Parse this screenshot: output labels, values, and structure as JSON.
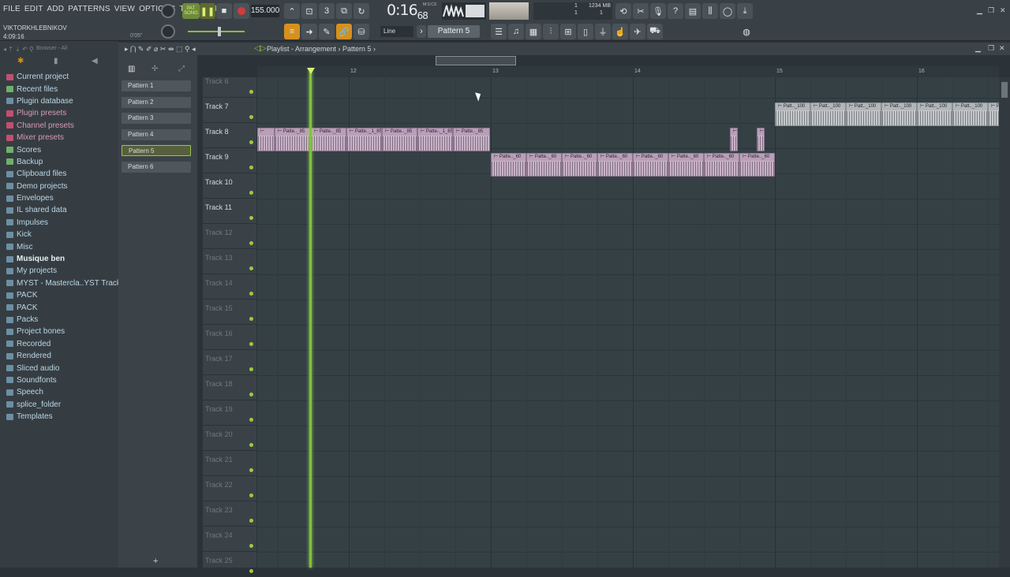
{
  "menu": [
    "FILE",
    "EDIT",
    "ADD",
    "PATTERNS",
    "VIEW",
    "OPTIONS",
    "TOOLS",
    "HELP"
  ],
  "hint": {
    "user": "VIKTORKHLEBNIKOV",
    "duration": "4:09:16",
    "small": "0'05\""
  },
  "transport": {
    "song_label": "SONG",
    "pat_label": "PAT",
    "tempo": "155.000",
    "time_main": "0:16",
    "time_sub": "68",
    "time_unit": "M:S:CS"
  },
  "cpu": {
    "val1": "1",
    "mem": "1234 MB",
    "val2": "1",
    "val3": "1"
  },
  "toolbar2": {
    "mode": "Line",
    "pattern": "Pattern 5"
  },
  "browser": {
    "title": "Browser - All",
    "items": [
      {
        "label": "Current project",
        "style": "accent"
      },
      {
        "label": "Recent files",
        "style": "green"
      },
      {
        "label": "Plugin database",
        "style": "normal"
      },
      {
        "label": "Plugin presets",
        "style": "pink"
      },
      {
        "label": "Channel presets",
        "style": "pink"
      },
      {
        "label": "Mixer presets",
        "style": "pink"
      },
      {
        "label": "Scores",
        "style": "green"
      },
      {
        "label": "Backup",
        "style": "green"
      },
      {
        "label": "Clipboard files",
        "style": "normal"
      },
      {
        "label": "Demo projects",
        "style": "normal"
      },
      {
        "label": "Envelopes",
        "style": "normal"
      },
      {
        "label": "IL shared data",
        "style": "normal"
      },
      {
        "label": "Impulses",
        "style": "normal"
      },
      {
        "label": "Kick",
        "style": "normal"
      },
      {
        "label": "Misc",
        "style": "normal"
      },
      {
        "label": "Musique ben",
        "style": "sel"
      },
      {
        "label": "My projects",
        "style": "normal"
      },
      {
        "label": "MYST - Mastercla..YST Track Ever",
        "style": "normal"
      },
      {
        "label": "PACK",
        "style": "normal"
      },
      {
        "label": "PACK",
        "style": "normal"
      },
      {
        "label": "Packs",
        "style": "normal"
      },
      {
        "label": "Project bones",
        "style": "normal"
      },
      {
        "label": "Recorded",
        "style": "normal"
      },
      {
        "label": "Rendered",
        "style": "normal"
      },
      {
        "label": "Sliced audio",
        "style": "normal"
      },
      {
        "label": "Soundfonts",
        "style": "normal"
      },
      {
        "label": "Speech",
        "style": "normal"
      },
      {
        "label": "splice_folder",
        "style": "normal"
      },
      {
        "label": "Templates",
        "style": "normal"
      }
    ]
  },
  "playlist": {
    "title": "Playlist - Arrangement › Pattern 5 ›",
    "patterns": [
      "Pattern 1",
      "Pattern 2",
      "Pattern 3",
      "Pattern 4",
      "Pattern 5",
      "Pattern 6"
    ],
    "selected_pattern": "Pattern 5",
    "ruler": [
      "12",
      "13",
      "14",
      "15",
      "16"
    ],
    "tracks": [
      {
        "name": "Track 6",
        "dim": true
      },
      {
        "name": "Track 7",
        "dim": false
      },
      {
        "name": "Track 8",
        "dim": false
      },
      {
        "name": "Track 9",
        "dim": false
      },
      {
        "name": "Track 10",
        "dim": false
      },
      {
        "name": "Track 11",
        "dim": false
      },
      {
        "name": "Track 12",
        "dim": true
      },
      {
        "name": "Track 13",
        "dim": true
      },
      {
        "name": "Track 14",
        "dim": true
      },
      {
        "name": "Track 15",
        "dim": true
      },
      {
        "name": "Track 16",
        "dim": true
      },
      {
        "name": "Track 17",
        "dim": true
      },
      {
        "name": "Track 18",
        "dim": true
      },
      {
        "name": "Track 19",
        "dim": true
      },
      {
        "name": "Track 20",
        "dim": true
      },
      {
        "name": "Track 21",
        "dim": true
      },
      {
        "name": "Track 22",
        "dim": true
      },
      {
        "name": "Track 23",
        "dim": true
      },
      {
        "name": "Track 24",
        "dim": true
      },
      {
        "name": "Track 25",
        "dim": true
      }
    ],
    "clip_labels": {
      "track8": [
        "",
        "Patte.._85",
        "Patte.._85",
        "Patte.._1_85",
        "Patte.._85",
        "Patte.._1_85",
        "Patte.._85",
        "",
        ""
      ],
      "track9": [
        "Patte.._60",
        "Patte.._60",
        "Patte.._60",
        "Patte.._60",
        "Patte.._60",
        "Patte.._60",
        "Patte.._60",
        "Patte.._60"
      ],
      "track7": [
        "Patt.._100",
        "Patt.._100",
        "Patt.._100",
        "Patt.._100",
        "Patt.._100",
        "Patt.._100",
        "Patt.._100"
      ]
    }
  }
}
